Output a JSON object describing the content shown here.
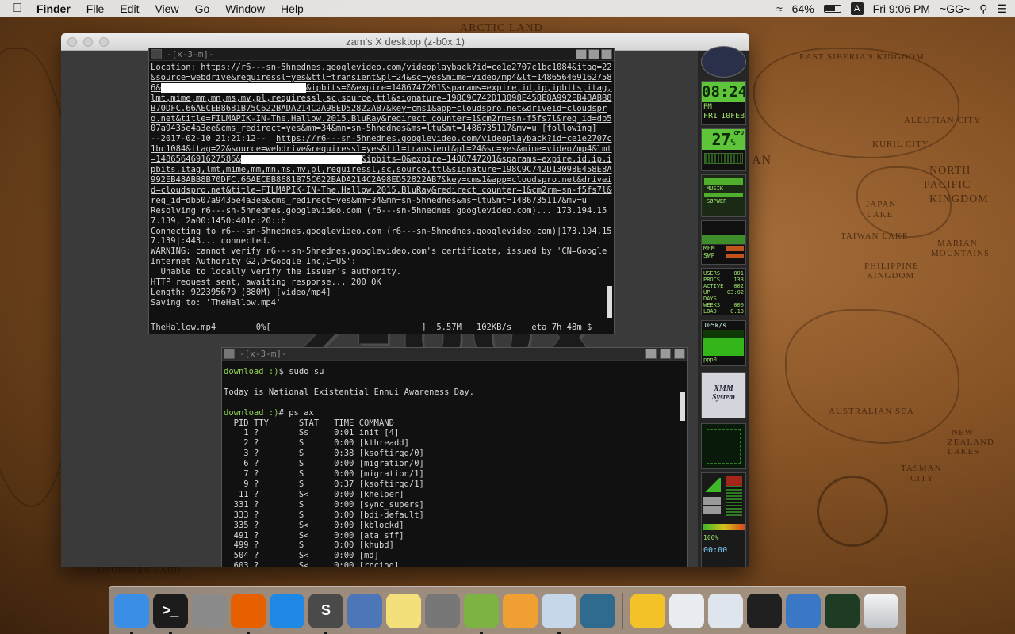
{
  "menubar": {
    "app": "Finder",
    "items": [
      "File",
      "Edit",
      "View",
      "Go",
      "Window",
      "Help"
    ],
    "battery": "64%",
    "input_source": "A",
    "clock": "Fri 9:06 PM",
    "user": "~GG~"
  },
  "map_labels": [
    "Arctic Land",
    "East Siberian Kingdom",
    "Aleutian City",
    "Kuril City",
    "North",
    "Pacific",
    "Kingdom",
    "Japan",
    "Lake",
    "Taiwan Lake",
    "Marian",
    "Mountains",
    "Philippine",
    "Kingdom",
    "Australian Sea",
    "New",
    "Zealand",
    "Lakes",
    "Tasman",
    "City",
    "Amundsen Land",
    "AN"
  ],
  "xwindow": {
    "title": "zam's X desktop (z-b0x:1)",
    "background_text": "z-b0x"
  },
  "term1": {
    "title": "-[x-3-m]-",
    "lines": [
      [
        {
          "t": "Location: "
        },
        {
          "t": "https://r6---sn-5hnednes.googlevideo.com/videoplayback?id=ce1e2707c1bc1084&itag=22&source=webdrive&requiressl=yes&ttl=transient&pl=24&sc=yes&mime=video/mp4&lt=1486564691627586&",
          "u": true
        },
        {
          "t": "XXXXXXXXXXXXXXXXXXXXXXXXXXXXX",
          "b": true
        },
        {
          "t": "&ipbits=0&expire=1486747201&sparams=expire,id,ip,ipbits,itag,lmt,mime,mm,mn,ms,mv,pl,requiressl,sc,source,ttl&signature=198C9C742D13098E458E8A992EB48ABB8B70DFC.66AECEB8681B75C622BADA214C2A98ED52822AB7&key=cms1&app=cloudspro.net&driveid=cloudspro.net&title=FILMAPIK-IN-The.Hallow.2015.BluRay&redirect_counter=1&cm2rm=sn-f5fs7l&req_id=db507a9435e4a3ee&cms_redirect=yes&mm=34&mn=sn-5hnednes&ms=ltu&mt=1486735117&mv=u",
          "u": true
        },
        {
          "t": " [following]"
        }
      ],
      [
        {
          "t": "--2017-02-10 21:21:12--  "
        },
        {
          "t": "https://r6---sn-5hnednes.googlevideo.com/videoplayback?id=ce1e2707c1bc1084&itag=22&source=webdrive&requiressl=yes&ttl=transient&pl=24&sc=yes&mime=video/mp4&lmt=1486564691627586&",
          "u": true
        },
        {
          "t": "XXXXXXXXXXXXXXXXXXXXXXXX",
          "b": true
        },
        {
          "t": "&ipbits=0&expire=1486747201&sparams=expire,id,ip,ipbits,itag,lmt,mime,mm,mn,ms,mv,pl,requiressl,sc,source,ttl&signature=198C9C742D13098E458E8A992EB48ABB8B70DFC.66AECEB8681B75C622BADA214C2A98ED52822AB7&key=cms1&app=cloudspro.net&driveid=cloudspro.net&title=FILMAPIK-IN-The.Hallow.2015.BluRay&redirect_counter=1&cm2rm=sn-f5fs7l&req_id=db507a9435e4a3ee&cms_redirect=yes&mm=34&mn=sn-5hnednes&ms=ltu&mt=1486735117&mv=u",
          "u": true
        }
      ],
      [
        {
          "t": "Resolving r6---sn-5hnednes.googlevideo.com (r6---sn-5hnednes.googlevideo.com)... 173.194.157.139, 2a00:1450:401c:20::b"
        }
      ],
      [
        {
          "t": "Connecting to r6---sn-5hnednes.googlevideo.com (r6---sn-5hnednes.googlevideo.com)|173.194.157.139|:443... connected."
        }
      ],
      [
        {
          "t": "WARNING: cannot verify r6---sn-5hnednes.googlevideo.com's certificate, issued by 'CN=Google Internet Authority G2,O=Google Inc,C=US':"
        }
      ],
      [
        {
          "t": "  Unable to locally verify the issuer's authority."
        }
      ],
      [
        {
          "t": "HTTP request sent, awaiting response... 200 OK"
        }
      ],
      [
        {
          "t": "Length: 922395679 (880M) [video/mp4]"
        }
      ],
      [
        {
          "t": "Saving to: 'TheHallow.mp4'"
        }
      ]
    ],
    "status": "TheHallow.mp4        0%[                              ]  5.57M   102KB/s    eta 7h 48m $"
  },
  "term2": {
    "title": "-[x-3-m]-",
    "lines": [
      [
        {
          "t": "download ",
          "p": true
        },
        {
          "t": ":)",
          "p": true
        },
        {
          "t": "$ sudo su"
        }
      ],
      [
        {
          "t": ""
        }
      ],
      [
        {
          "t": "Today is National Existential Ennui Awareness Day."
        }
      ],
      [
        {
          "t": ""
        }
      ],
      [
        {
          "t": "download ",
          "p": true
        },
        {
          "t": ":)",
          "p": true
        },
        {
          "t": "# ps ax"
        }
      ],
      [
        {
          "t": "  PID TTY      STAT   TIME COMMAND"
        }
      ],
      [
        {
          "t": "    1 ?        Ss     0:01 init [4]"
        }
      ],
      [
        {
          "t": "    2 ?        S      0:00 [kthreadd]"
        }
      ],
      [
        {
          "t": "    3 ?        S      0:38 [ksoftirqd/0]"
        }
      ],
      [
        {
          "t": "    6 ?        S      0:00 [migration/0]"
        }
      ],
      [
        {
          "t": "    7 ?        S      0:00 [migration/1]"
        }
      ],
      [
        {
          "t": "    9 ?        S      0:37 [ksoftirqd/1]"
        }
      ],
      [
        {
          "t": "   11 ?        S<     0:00 [khelper]"
        }
      ],
      [
        {
          "t": "  331 ?        S      0:00 [sync_supers]"
        }
      ],
      [
        {
          "t": "  333 ?        S      0:00 [bdi-default]"
        }
      ],
      [
        {
          "t": "  335 ?        S<     0:00 [kblockd]"
        }
      ],
      [
        {
          "t": "  491 ?        S<     0:00 [ata_sff]"
        }
      ],
      [
        {
          "t": "  499 ?        S      0:00 [khubd]"
        }
      ],
      [
        {
          "t": "  504 ?        S<     0:00 [md]"
        }
      ],
      [
        {
          "t": "  603 ?        S<     0:00 [rpciod]"
        }
      ]
    ]
  },
  "dockapps": {
    "time": "08:24",
    "time_ampm": "PM",
    "date_day": "FRI",
    "date": "10FEB",
    "cpu_pct": "27",
    "cpu_unit": "%",
    "cpu_label": "CPU",
    "mixer": "MUSIK",
    "mixer2": "SØPWER",
    "mem": "MEM",
    "swp": "SWP",
    "sys_rows": [
      [
        "USERS",
        "001"
      ],
      [
        "PROCS",
        "133"
      ],
      [
        "ACTIVE",
        "002"
      ],
      [
        "UP",
        "03:02"
      ],
      [
        "DAYS",
        ""
      ],
      [
        "WEEKS",
        "000"
      ],
      [
        "LOAD",
        "0.13"
      ]
    ],
    "net_rate": "105k/s",
    "net_if": "ppp0",
    "logo": "XMM System",
    "vol_pct": "100%",
    "timer": "00:00"
  },
  "dock": {
    "items": [
      {
        "name": "finder",
        "label": "",
        "color": "#3a8ee6",
        "running": true
      },
      {
        "name": "terminal",
        "label": ">_",
        "color": "#1c1c1c",
        "running": true
      },
      {
        "name": "launchpad",
        "label": "",
        "color": "#8a8a8a",
        "running": false
      },
      {
        "name": "firefox",
        "label": "",
        "color": "#e66000",
        "running": true
      },
      {
        "name": "safari",
        "label": "",
        "color": "#1e88e5",
        "running": false
      },
      {
        "name": "sublime-text",
        "label": "S",
        "color": "#4a4a4a",
        "running": true
      },
      {
        "name": "preview-bird",
        "label": "",
        "color": "#4d76b8",
        "running": false
      },
      {
        "name": "notes",
        "label": "",
        "color": "#f3e07a",
        "running": false
      },
      {
        "name": "system-preferences",
        "label": "",
        "color": "#777",
        "running": false
      },
      {
        "name": "android-studio",
        "label": "",
        "color": "#7cb342",
        "running": true
      },
      {
        "name": "vlc",
        "label": "",
        "color": "#f0a033",
        "running": false
      },
      {
        "name": "preview",
        "label": "",
        "color": "#c6d7ea",
        "running": true
      },
      {
        "name": "screen-sharing",
        "label": "",
        "color": "#2f6b8e",
        "running": false
      }
    ],
    "minimized": [
      {
        "name": "taskcheck",
        "color": "#f2c228"
      },
      {
        "name": "window-thumb-1",
        "color": "#e9edf2"
      },
      {
        "name": "window-thumb-2",
        "color": "#dfe5ec"
      },
      {
        "name": "window-thumb-3",
        "color": "#202020"
      },
      {
        "name": "window-thumb-4",
        "color": "#3a78c6"
      },
      {
        "name": "window-thumb-5",
        "color": "#1e3b23"
      }
    ],
    "trash": "trash"
  }
}
